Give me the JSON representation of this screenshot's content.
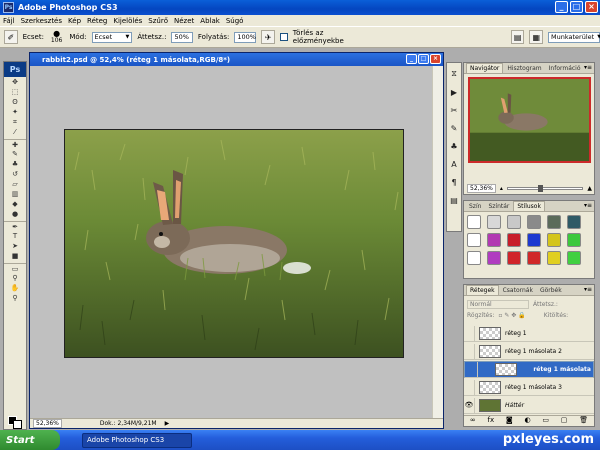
{
  "window": {
    "app_badge": "Ps",
    "title": "Adobe Photoshop CS3"
  },
  "menu": [
    "Fájl",
    "Szerkesztés",
    "Kép",
    "Réteg",
    "Kijelölés",
    "Szűrő",
    "Nézet",
    "Ablak",
    "Súgó"
  ],
  "options": {
    "brush_label": "Ecset:",
    "brush_size": "106",
    "mode_label": "Mód:",
    "mode_value": "Ecset",
    "opacity_label": "Áttetsz.:",
    "opacity_value": "50%",
    "flow_label": "Folyatás:",
    "flow_value": "100%",
    "erase_history_label": "Törlés az előzményekbe",
    "workspace_label": "Munkaterület"
  },
  "document": {
    "title": "rabbit2.psd @ 52,4% (réteg 1 másolata,RGB/8*)",
    "zoom": "52,36%",
    "doc_size": "Dok.: 2,34M/9,21M"
  },
  "navigator": {
    "tabs": [
      "Navigátor",
      "Hisztogram",
      "Információ"
    ],
    "zoom": "52,36%"
  },
  "styles_panel": {
    "tabs": [
      "Szín",
      "Színtár",
      "Stílusok"
    ],
    "swatch_colors": [
      "#ffffff",
      "#d8d8d8",
      "#c8c8c8",
      "#8a8a8a",
      "#5b6b5a",
      "#2f5a66",
      "#ffffff",
      "#b23ab2",
      "#c81e28",
      "#1e3ad0",
      "#d4c51a",
      "#3cc83c",
      "#ffffff",
      "#b03cc0",
      "#d0242a",
      "#d02828",
      "#e0cf20",
      "#40d040"
    ]
  },
  "layers_panel": {
    "tabs": [
      "Rétegek",
      "Csatornák",
      "Görbék"
    ],
    "blend_mode": "Normál",
    "opacity_label": "Áttetsz.:",
    "lock_label": "Rögzítés:",
    "fill_label": "Kitöltés:",
    "layers": [
      {
        "name": "réteg 1",
        "visible": false,
        "selected": false
      },
      {
        "name": "réteg 1 másolata 2",
        "visible": false,
        "selected": false
      },
      {
        "name": "réteg 1 másolata",
        "visible": false,
        "selected": true
      },
      {
        "name": "réteg 1 másolata 3",
        "visible": false,
        "selected": false
      },
      {
        "name": "Háttér",
        "visible": true,
        "selected": false
      }
    ]
  },
  "taskbar": {
    "start": "Start",
    "item": "Adobe Photoshop CS3"
  },
  "watermark": "pxleyes.com"
}
